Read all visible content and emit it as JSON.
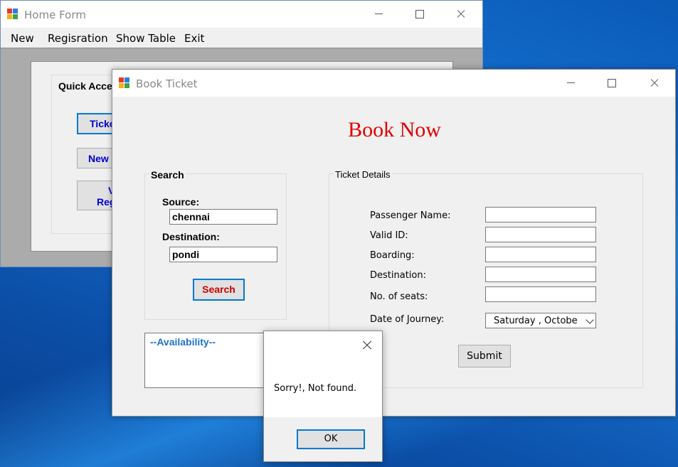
{
  "home_form": {
    "title": "Home Form",
    "menu": {
      "new": "New",
      "registration": "Regisration",
      "show_table": "Show Table",
      "exit": "Exit"
    },
    "quick_access": {
      "title": "Quick Acce",
      "ticket_button": "Ticke",
      "new_button": "New",
      "view_button_line1": "V",
      "view_button_line2": "Reg"
    }
  },
  "book_ticket": {
    "title": "Book Ticket",
    "heading": "Book Now",
    "search": {
      "group_title": "Search",
      "source_label": "Source:",
      "source_value": "chennai",
      "destination_label": "Destination:",
      "destination_value": "pondi",
      "search_button": "Search"
    },
    "availability_title": "--Availability--",
    "ticket_details": {
      "group_title": "Ticket Details",
      "passenger_name_label": "Passenger Name:",
      "valid_id_label": "Valid ID:",
      "boarding_label": "Boarding:",
      "destination_label": "Destination:",
      "seats_label": "No. of seats:",
      "date_label": "Date of Journey:",
      "date_value": "Saturday  ,   Octobe",
      "submit_button": "Submit"
    }
  },
  "message_box": {
    "text": "Sorry!, Not found.",
    "ok_button": "OK"
  },
  "colors": {
    "heading_red": "#e00000",
    "search_text_red": "#cc0000",
    "focus_blue": "#0078d7",
    "availability_blue": "#1e73c8",
    "quick_access_blue": "#0000cc"
  }
}
